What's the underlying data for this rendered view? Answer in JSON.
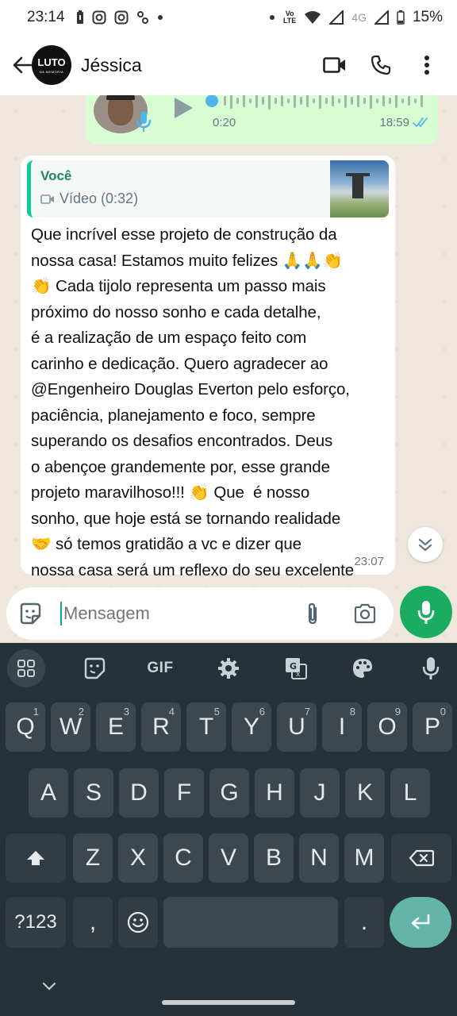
{
  "status_bar": {
    "time": "23:14",
    "network_label": "4G",
    "volte_label": "Vo\nLTE",
    "battery": "15%"
  },
  "header": {
    "contact_name": "Jéssica",
    "avatar_text": "LUTO",
    "avatar_subtext": "NA MEMÓRIA",
    "icons": [
      "back-arrow-icon",
      "video-call-icon",
      "phone-icon",
      "more-vert-icon"
    ]
  },
  "audio_message": {
    "duration": "0:20",
    "time": "18:59",
    "status": "read",
    "accent": "#4fb6ec"
  },
  "message": {
    "quote_author": "Você",
    "quote_type": "Vídeo (0:32)",
    "text": "Que incrível esse projeto de construção da\nnossa casa! Estamos muito felizes 🙏🙏👏\n👏 Cada tijolo representa um passo mais\npróximo do nosso sonho e cada detalhe,\né a realização de um espaço feito com\ncarinho e dedicação. Quero agradecer ao\n@Engenheiro Douglas Everton pelo esforço,\npaciência, planejamento e foco, sempre\nsuperando os desafios encontrados. Deus\no abençoe grandemente por, esse grande\nprojeto maravilhoso!!! 👏 Que  é nosso\nsonho, que hoje está se tornando realidade\n🤝 só temos gratidão a vc e dizer que\nnossa casa será um reflexo do seu excelente\ntrabalho.",
    "time": "23:07"
  },
  "composer": {
    "placeholder": "Mensagem"
  },
  "keyboard": {
    "toolbar": [
      "apps-icon",
      "sticker-icon",
      "GIF",
      "settings-icon",
      "translate-icon",
      "palette-icon",
      "mic-icon"
    ],
    "row1": [
      {
        "key": "Q",
        "hint": "1"
      },
      {
        "key": "W",
        "hint": "2"
      },
      {
        "key": "E",
        "hint": "3"
      },
      {
        "key": "R",
        "hint": "4"
      },
      {
        "key": "T",
        "hint": "5"
      },
      {
        "key": "Y",
        "hint": "6"
      },
      {
        "key": "U",
        "hint": "7"
      },
      {
        "key": "I",
        "hint": "8"
      },
      {
        "key": "O",
        "hint": "9"
      },
      {
        "key": "P",
        "hint": "0"
      }
    ],
    "row2": [
      "A",
      "S",
      "D",
      "F",
      "G",
      "H",
      "J",
      "K",
      "L"
    ],
    "row3": [
      "Z",
      "X",
      "C",
      "V",
      "B",
      "N",
      "M"
    ],
    "symbols_label": "?123",
    "comma_label": ",",
    "period_label": "."
  },
  "colors": {
    "chat_background": "#efe7dd",
    "outgoing_bubble": "#d9fdd3",
    "accent_green": "#1aad5f",
    "keyboard_bg": "#263238"
  }
}
